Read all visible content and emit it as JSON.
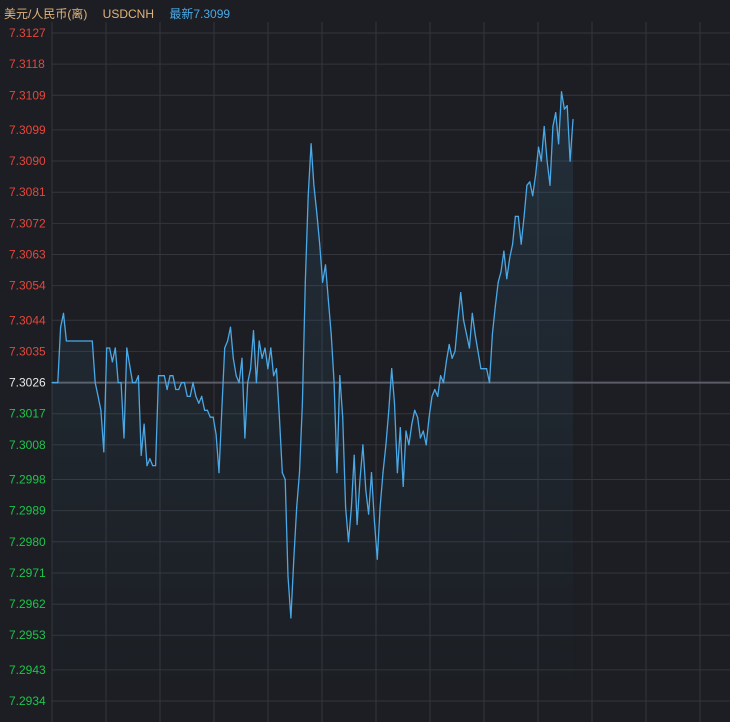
{
  "header": {
    "name": "美元/人民币(离)",
    "code": "USDCNH",
    "latest": "最新7.3099"
  },
  "colors": {
    "background": "#1c1e23",
    "grid": "#33363d",
    "line": "#4aa8e6",
    "up_label": "#e5463b",
    "down_label": "#1ec44a",
    "base_label": "#e8e8e8",
    "base_line": "#5a5d66"
  },
  "chart_data": {
    "type": "line",
    "title": "",
    "xlabel": "",
    "ylabel": "",
    "ylim": [
      7.2934,
      7.3127
    ],
    "base_value": 7.3026,
    "grid": true,
    "y_ticks": [
      "7.3127",
      "7.3118",
      "7.3109",
      "7.3099",
      "7.3090",
      "7.3081",
      "7.3072",
      "7.3063",
      "7.3054",
      "7.3044",
      "7.3035",
      "7.3026",
      "7.3017",
      "7.3008",
      "7.2998",
      "7.2989",
      "7.2980",
      "7.2971",
      "7.2962",
      "7.2953",
      "7.2943",
      "7.2934"
    ],
    "series": [
      {
        "values": [
          7.3026,
          7.3026,
          7.3026,
          7.3042,
          7.3046,
          7.3038,
          7.3038,
          7.3038,
          7.3038,
          7.3038,
          7.3038,
          7.3038,
          7.3038,
          7.3038,
          7.3038,
          7.3026,
          7.3022,
          7.3018,
          7.3006,
          7.3036,
          7.3036,
          7.3032,
          7.3036,
          7.3026,
          7.3026,
          7.301,
          7.3036,
          7.3031,
          7.3026,
          7.3026,
          7.3028,
          7.3005,
          7.3014,
          7.3002,
          7.3004,
          7.3002,
          7.3002,
          7.3028,
          7.3028,
          7.3028,
          7.3024,
          7.3028,
          7.3028,
          7.3024,
          7.3024,
          7.3026,
          7.3026,
          7.3022,
          7.3022,
          7.3026,
          7.3022,
          7.302,
          7.3022,
          7.3018,
          7.3018,
          7.3016,
          7.3016,
          7.3011,
          7.3,
          7.3018,
          7.3036,
          7.3038,
          7.3042,
          7.3033,
          7.3028,
          7.3026,
          7.3033,
          7.301,
          7.3026,
          7.303,
          7.3041,
          7.3026,
          7.3038,
          7.3033,
          7.3036,
          7.303,
          7.3036,
          7.3028,
          7.303,
          7.3016,
          7.3,
          7.2998,
          7.297,
          7.2958,
          7.2975,
          7.299,
          7.3,
          7.302,
          7.3055,
          7.308,
          7.3095,
          7.3083,
          7.3075,
          7.3066,
          7.3055,
          7.306,
          7.305,
          7.304,
          7.3026,
          7.3,
          7.3028,
          7.3016,
          7.299,
          7.298,
          7.299,
          7.3005,
          7.2985,
          7.2998,
          7.3008,
          7.2995,
          7.2988,
          7.3,
          7.2986,
          7.2975,
          7.299,
          7.3,
          7.3008,
          7.3018,
          7.303,
          7.302,
          7.3,
          7.3013,
          7.2996,
          7.3012,
          7.3008,
          7.3014,
          7.3018,
          7.3016,
          7.301,
          7.3012,
          7.3008,
          7.3016,
          7.3022,
          7.3024,
          7.3022,
          7.3028,
          7.3026,
          7.3032,
          7.3037,
          7.3033,
          7.3035,
          7.3044,
          7.3052,
          7.3044,
          7.304,
          7.3036,
          7.3046,
          7.304,
          7.3035,
          7.303,
          7.303,
          7.303,
          7.3026,
          7.304,
          7.3048,
          7.3055,
          7.3058,
          7.3064,
          7.3056,
          7.3062,
          7.3066,
          7.3074,
          7.3074,
          7.3066,
          7.3074,
          7.3083,
          7.3084,
          7.308,
          7.3086,
          7.3094,
          7.309,
          7.31,
          7.309,
          7.3083,
          7.31,
          7.3104,
          7.3095,
          7.311,
          7.3105,
          7.3106,
          7.309,
          7.3102
        ]
      }
    ]
  }
}
